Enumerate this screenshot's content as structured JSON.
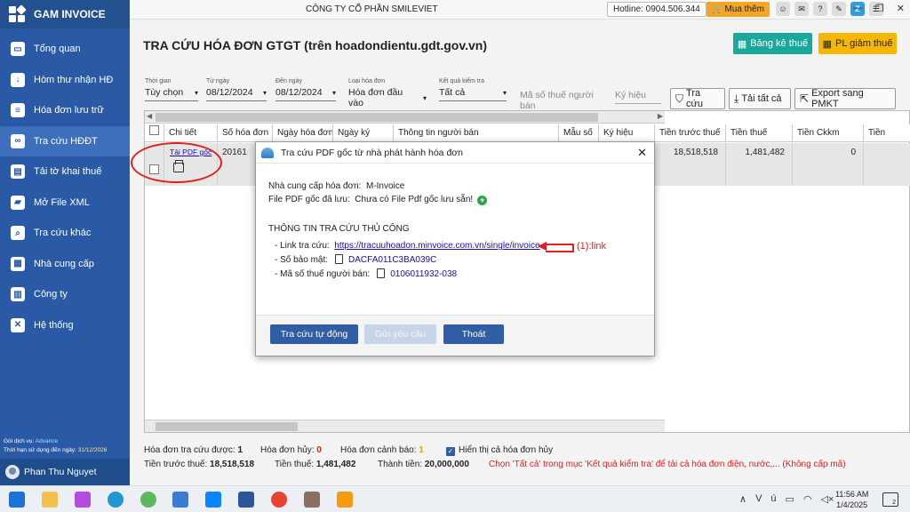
{
  "app": {
    "name": "GAM INVOICE"
  },
  "sidebar": {
    "items": [
      {
        "label": "Tổng quan",
        "icon": "monitor-icon"
      },
      {
        "label": "Hòm thư nhận HĐ",
        "icon": "download-icon"
      },
      {
        "label": "Hóa đơn lưu trữ",
        "icon": "document-icon"
      },
      {
        "label": "Tra cứu HĐĐT",
        "icon": "link-icon"
      },
      {
        "label": "Tải tờ khai thuế",
        "icon": "clipboard-icon"
      },
      {
        "label": "Mở File XML",
        "icon": "folder-icon"
      },
      {
        "label": "Tra cứu khác",
        "icon": "search-icon"
      },
      {
        "label": "Nhà cung cấp",
        "icon": "vendor-icon"
      },
      {
        "label": "Công ty",
        "icon": "building-icon"
      },
      {
        "label": "Hệ thống",
        "icon": "tools-icon"
      }
    ],
    "service_label": "Gói dịch vụ:",
    "service_value": "Advance",
    "expiry_label": "Thời hạn sử dụng đến ngày:",
    "expiry_value": "31/12/2026",
    "user_name": "Phan Thu Nguyet"
  },
  "topbar": {
    "company": "CÔNG TY CỔ PHẦN SMILEVIET",
    "hotline": "Hotline: 0904.506.344",
    "buy_label": "Mua thêm"
  },
  "page": {
    "title": "TRA CỨU HÓA ĐƠN GTGT (trên hoadondientu.gdt.gov.vn)",
    "btn_bangke": "Bảng kê thuế",
    "btn_pl": "PL giảm thuế"
  },
  "filters": {
    "time_label": "Thời gian",
    "time_value": "Tùy chọn",
    "from_label": "Từ ngày",
    "from_value": "08/12/2024",
    "to_label": "Đến ngày",
    "to_value": "08/12/2024",
    "type_label": "Loại hóa đơn",
    "type_value": "Hóa đơn đầu vào",
    "result_label": "Kết quả kiểm tra",
    "result_value": "Tất cả",
    "tax_placeholder": "Mã số thuế người bán",
    "symbol_placeholder": "Ký hiệu",
    "btn_search": "Tra cứu",
    "btn_download_all": "Tải tất cả",
    "btn_export": "Export sang PMKT"
  },
  "grid": {
    "headers": [
      "Chi tiết",
      "Số hóa đơn",
      "Ngày hóa đơn",
      "Ngày ký",
      "Thông tin người bán",
      "Mẫu số",
      "Ký hiệu",
      "Tiền trước thuế",
      "Tiền thuế",
      "Tiền Ckkm",
      "Tiền"
    ],
    "row": {
      "pdf_link": "Tải PDF gốc",
      "invoice_no": "20161",
      "pre_tax": "18,518,518",
      "tax": "1,481,482",
      "discount": "0"
    }
  },
  "dialog": {
    "title": "Tra cứu PDF gốc từ nhà phát hành hóa đơn",
    "provider_label": "Nhà cung cấp hóa đơn:",
    "provider_value": "M-Invoice",
    "pdf_label": "File PDF gốc đã lưu:",
    "pdf_value": "Chưa có File Pdf gốc lưu sẵn!",
    "section": "THÔNG TIN TRA CỨU THỦ CÔNG",
    "link_label": "- Link tra cứu:",
    "link_value": "https://tracuuhoadon.minvoice.com.vn/single/invoice",
    "secret_label": "- Số bảo mật:",
    "secret_value": "DACFA011C3BA039C",
    "seller_tax_label": "- Mã số thuế người bán:",
    "seller_tax_value": "0106011932-038",
    "annotation": "(1):link",
    "btn_auto": "Tra cứu tự động",
    "btn_request": "Gửi yêu cầu",
    "btn_exit": "Thoát"
  },
  "summary": {
    "count_label": "Hóa đơn tra cứu được:",
    "count_value": "1",
    "cancel_label": "Hóa đơn hủy:",
    "cancel_value": "0",
    "warn_label": "Hóa đơn cảnh báo:",
    "warn_value": "1",
    "show_cancel_label": "Hiển thị cả hóa đơn hủy",
    "pretax_label": "Tiền trước thuế:",
    "pretax_value": "18,518,518",
    "tax_label": "Tiền thuế:",
    "tax_value": "1,481,482",
    "total_label": "Thành tiền:",
    "total_value": "20,000,000",
    "note": "Chọn 'Tất cả' trong mục 'Kết quả kiểm tra' để tải cả hóa đơn điện, nước,... (Không cấp mã)"
  },
  "taskbar": {
    "time": "11:56 AM",
    "date": "1/4/2025",
    "notifications": "2"
  }
}
